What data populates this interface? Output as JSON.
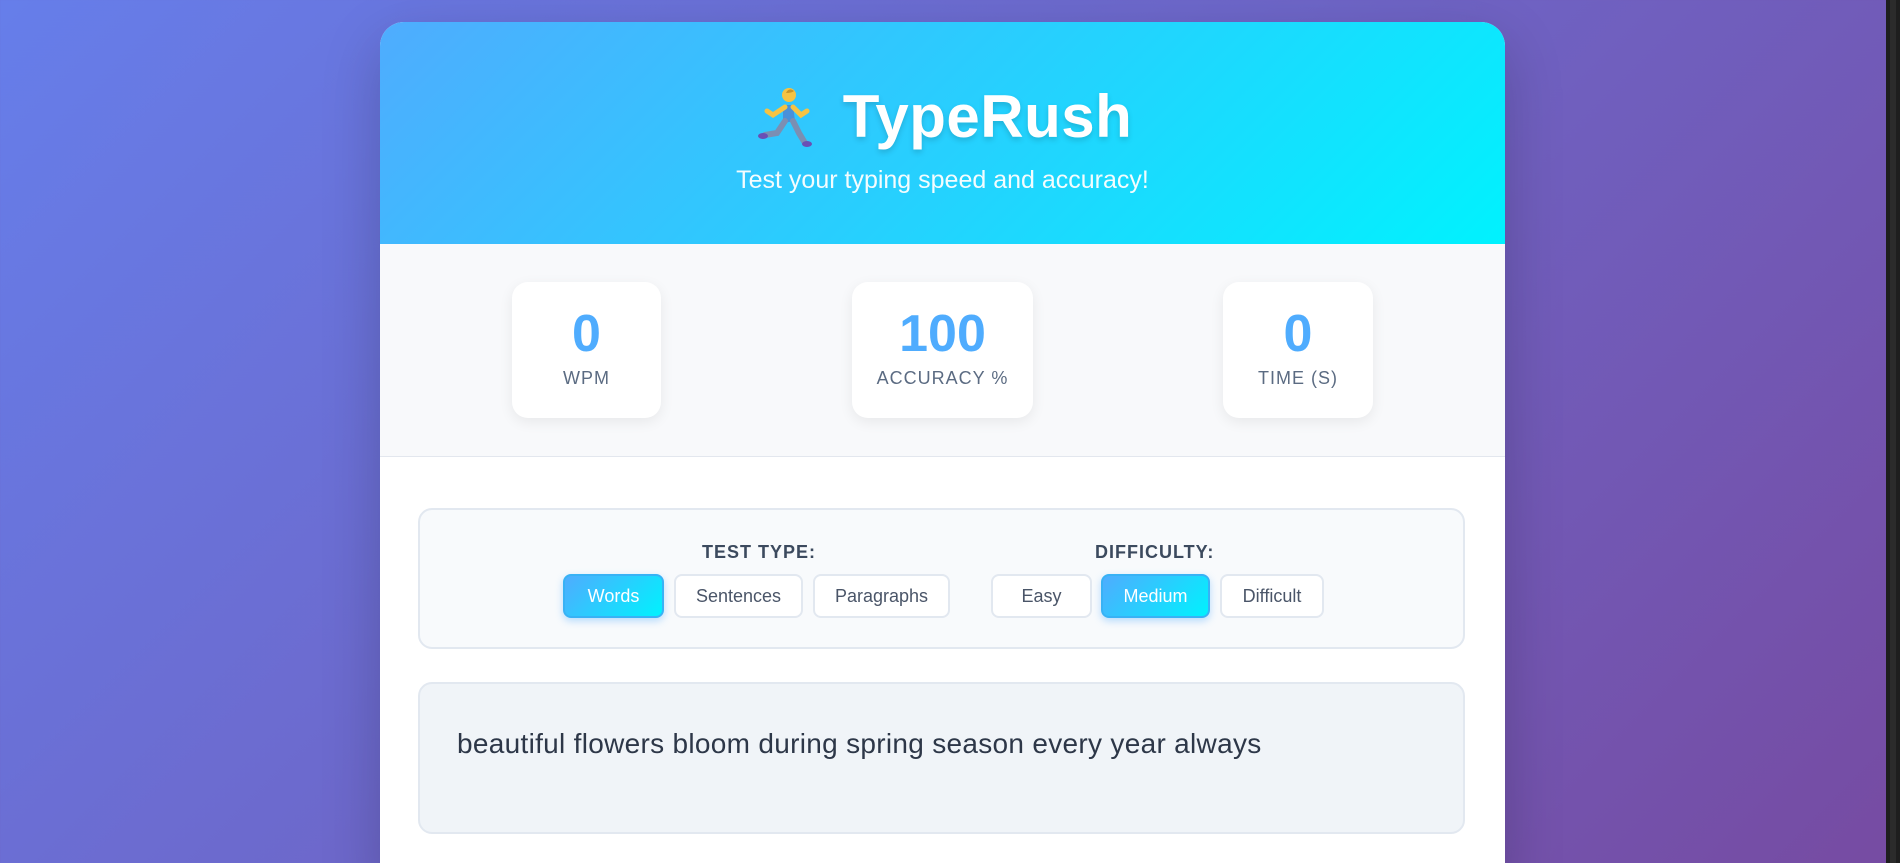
{
  "app": {
    "title": "TypeRush",
    "subtitle": "Test your typing speed and accuracy!",
    "logo_icon": "runner-icon"
  },
  "stats": {
    "wpm": {
      "value": "0",
      "label": "WPM"
    },
    "accuracy": {
      "value": "100",
      "label": "ACCURACY %"
    },
    "time": {
      "value": "0",
      "label": "TIME (S)"
    }
  },
  "controls": {
    "test_type": {
      "label": "TEST TYPE:",
      "options": [
        "Words",
        "Sentences",
        "Paragraphs"
      ],
      "selected": "Words"
    },
    "difficulty": {
      "label": "DIFFICULTY:",
      "options": [
        "Easy",
        "Medium",
        "Difficult"
      ],
      "selected": "Medium"
    }
  },
  "prompt": {
    "text": "beautiful flowers bloom during spring season every year always"
  },
  "colors": {
    "accent": "#4facfe",
    "accent_end": "#00f2fe",
    "background_start": "#667eea",
    "background_end": "#764ba2"
  }
}
